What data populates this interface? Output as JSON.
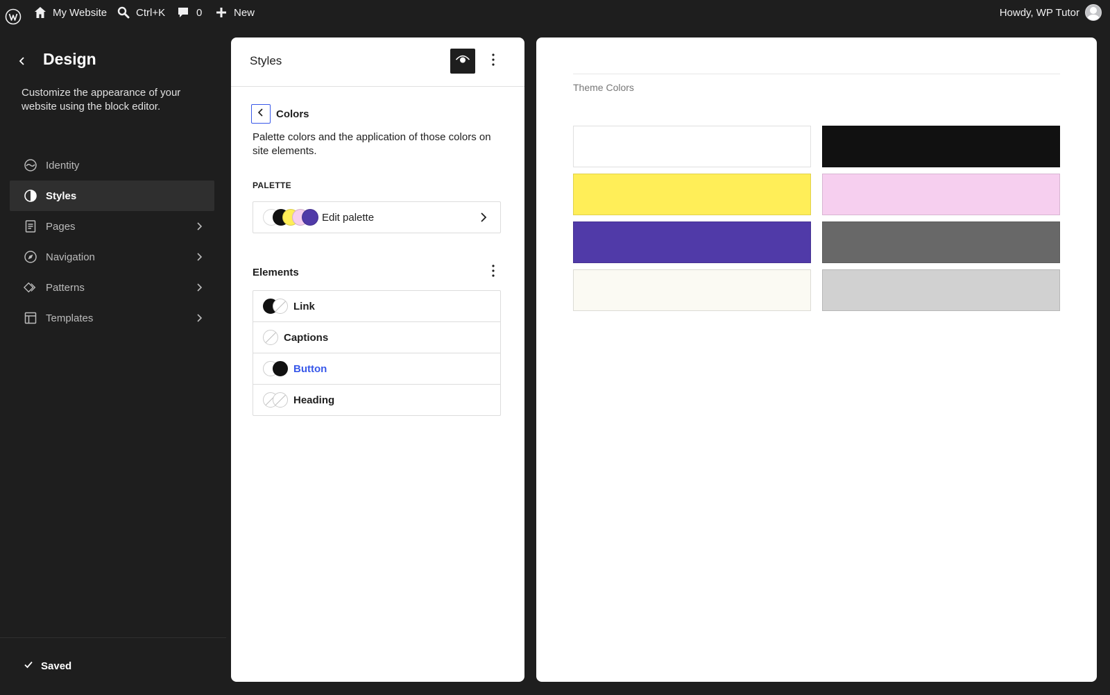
{
  "admin_bar": {
    "site_name": "My Website",
    "search_shortcut": "Ctrl+K",
    "comments_count": "0",
    "new_label": "New",
    "howdy": "Howdy, WP Tutor"
  },
  "sidebar": {
    "title": "Design",
    "description": "Customize the appearance of your website using the block editor.",
    "items": [
      {
        "label": "Identity",
        "icon": "identity-icon",
        "active": false,
        "has_chevron": false
      },
      {
        "label": "Styles",
        "icon": "styles-icon",
        "active": true,
        "has_chevron": false
      },
      {
        "label": "Pages",
        "icon": "page-icon",
        "active": false,
        "has_chevron": true
      },
      {
        "label": "Navigation",
        "icon": "navigation-icon",
        "active": false,
        "has_chevron": true
      },
      {
        "label": "Patterns",
        "icon": "patterns-icon",
        "active": false,
        "has_chevron": true
      },
      {
        "label": "Templates",
        "icon": "templates-icon",
        "active": false,
        "has_chevron": true
      }
    ],
    "status": "Saved"
  },
  "styles_panel": {
    "title": "Styles",
    "section_title": "Colors",
    "section_description": "Palette colors and the application of those colors on site elements.",
    "palette_heading": "PALETTE",
    "edit_palette_label": "Edit palette",
    "palette_preview_colors": [
      "#ffffff",
      "#111111",
      "#ffee58",
      "#f6cfef",
      "#503aa8"
    ],
    "elements_heading": "Elements",
    "elements": [
      {
        "label": "Link",
        "indicators": [
          "#111111",
          "none"
        ],
        "highlight": false
      },
      {
        "label": "Captions",
        "indicators": [
          "none"
        ],
        "highlight": false
      },
      {
        "label": "Button",
        "indicators": [
          "#ffffff",
          "#111111"
        ],
        "highlight": true
      },
      {
        "label": "Heading",
        "indicators": [
          "none",
          "none"
        ],
        "highlight": false
      }
    ]
  },
  "preview": {
    "title": "Theme Colors",
    "colors": [
      "#ffffff",
      "#111111",
      "#ffee58",
      "#f6cfef",
      "#503aa8",
      "#686868",
      "#fbfaf3",
      "#d1d1d1"
    ]
  },
  "theme": {
    "accent": "#3858e9",
    "chrome_bg": "#1e1e1e",
    "active_item_bg": "#2f2f2f"
  }
}
